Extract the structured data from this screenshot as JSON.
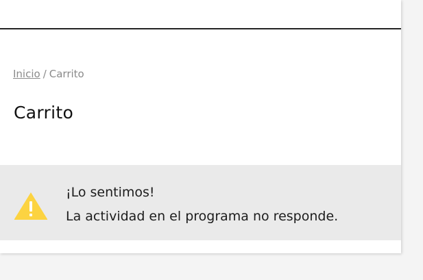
{
  "breadcrumb": {
    "home_label": "Inicio",
    "separator": "/",
    "current_label": "Carrito"
  },
  "page": {
    "title": "Carrito"
  },
  "alert": {
    "icon": "warning-triangle-icon",
    "icon_color": "#fcd341",
    "title": "¡Lo sentimos!",
    "message": "La actividad en el programa no responde."
  },
  "colors": {
    "background": "#f4f4f4",
    "card": "#ffffff",
    "alert_background": "#eaeaea",
    "header_rule": "#222222"
  }
}
